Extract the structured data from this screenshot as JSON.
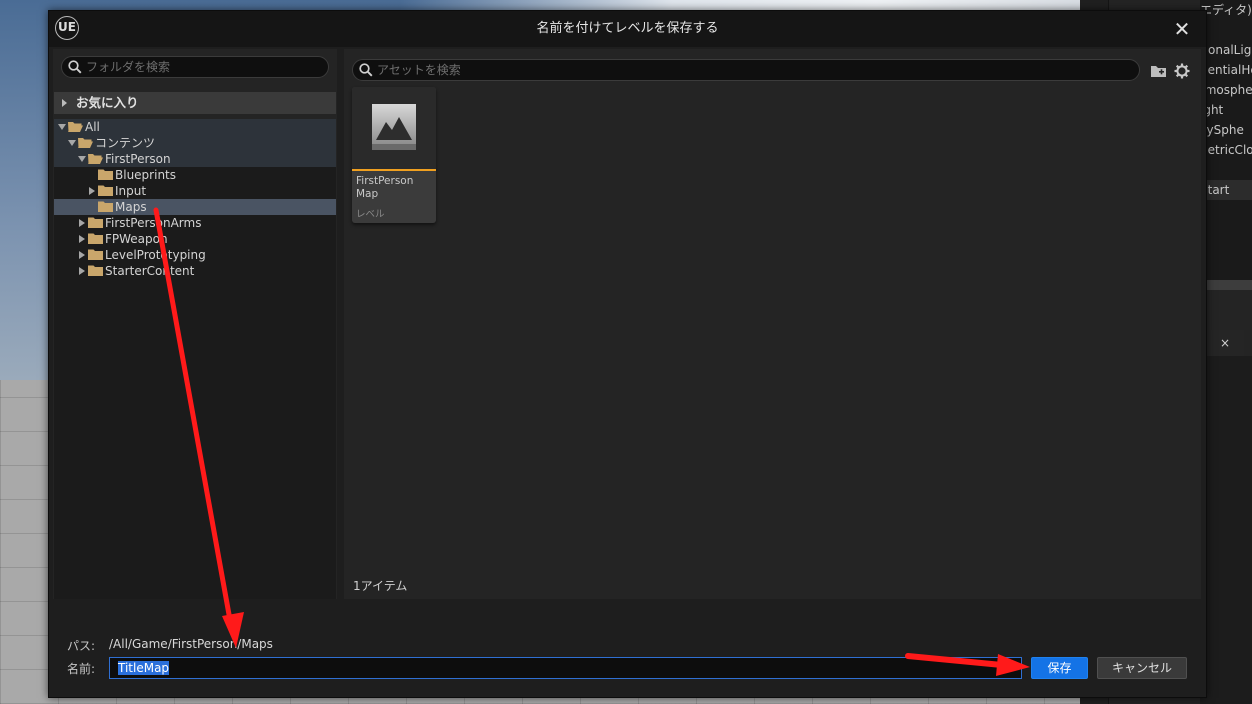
{
  "dialog": {
    "title": "名前を付けてレベルを保存する",
    "logo": "UE"
  },
  "folder_search": {
    "placeholder": "フォルダを検索"
  },
  "favorites": {
    "label": "お気に入り"
  },
  "tree": [
    {
      "label": "All",
      "expanded": true
    },
    {
      "label": "コンテンツ",
      "expanded": true
    },
    {
      "label": "FirstPerson",
      "expanded": true
    },
    {
      "label": "Blueprints"
    },
    {
      "label": "Input",
      "expanded": false
    },
    {
      "label": "Maps",
      "selected": true
    },
    {
      "label": "FirstPersonArms",
      "expanded": false
    },
    {
      "label": "FPWeapon",
      "expanded": false
    },
    {
      "label": "LevelPrototyping",
      "expanded": false
    },
    {
      "label": "StarterContent",
      "expanded": false
    }
  ],
  "asset_search": {
    "placeholder": "アセットを検索"
  },
  "assets": [
    {
      "name": "FirstPerson Map",
      "type": "レベル"
    }
  ],
  "item_count": "1アイテム",
  "path": {
    "label": "パス:",
    "value": "/All/Game/FirstPerson/Maps"
  },
  "name": {
    "label": "名前:",
    "value": "TitleMap"
  },
  "buttons": {
    "save": "保存",
    "cancel": "キャンセル"
  },
  "background_outliner": [
    "エディタ)",
    "g",
    "tionalLig",
    "nentialHe",
    "tmosphe",
    "ight",
    "kySphe",
    "netricClo",
    "",
    "Start"
  ],
  "background_tab_close": "×",
  "colors": {
    "accent": "#1473e6",
    "level_bar": "#f0a020",
    "annotation_arrow": "#ff1a1a",
    "folder": "#c9a66b"
  },
  "icons": [
    "search-icon",
    "folder-icon",
    "add-folder-icon",
    "gear-icon",
    "close-icon",
    "level-thumbnail-icon"
  ]
}
